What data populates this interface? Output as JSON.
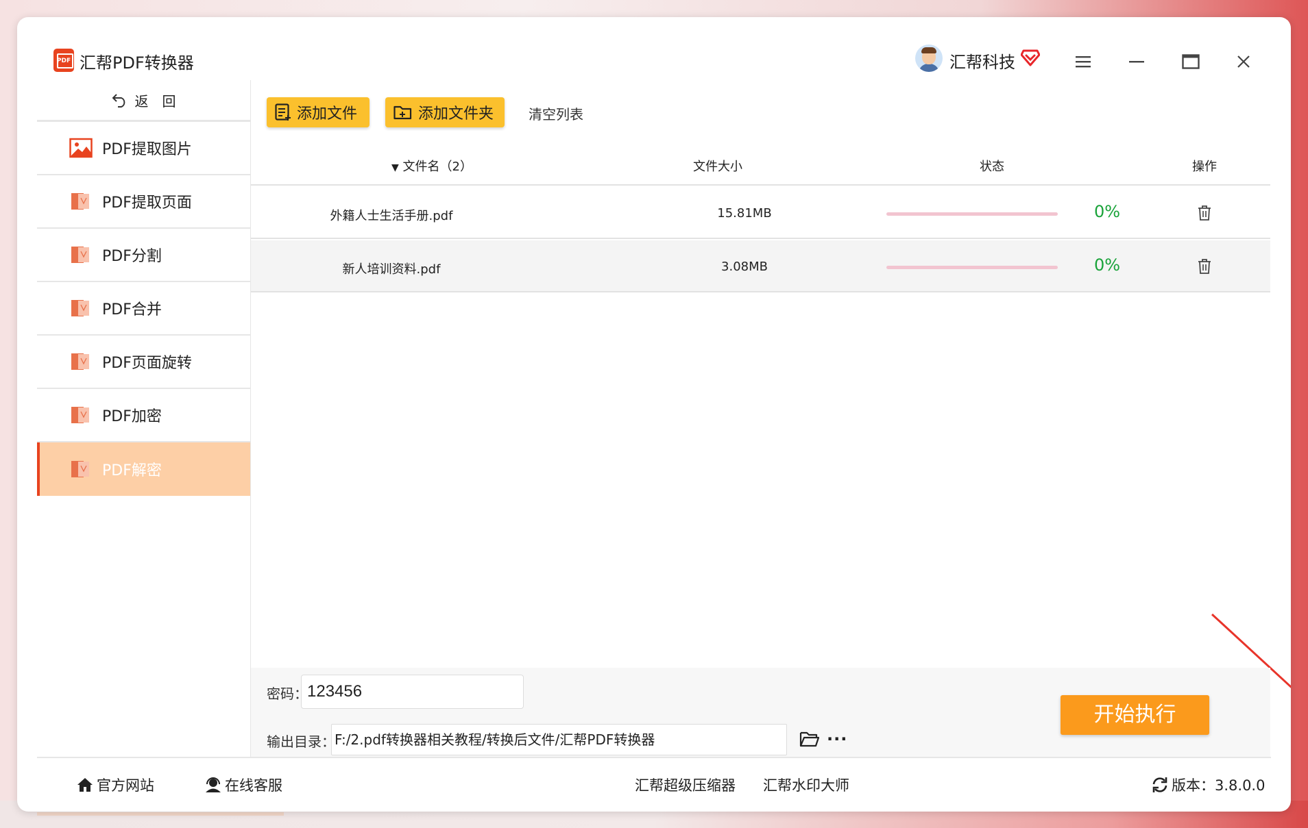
{
  "app": {
    "title": "汇帮PDF转换器",
    "logo_text": "PDF"
  },
  "user": {
    "name": "汇帮科技"
  },
  "sidebar": {
    "back_label": "返　回",
    "items": [
      {
        "label": "PDF提取图片",
        "icon": "image-icon",
        "active": false
      },
      {
        "label": "PDF提取页面",
        "icon": "pdf-file-icon",
        "active": false
      },
      {
        "label": "PDF分割",
        "icon": "pdf-file-icon",
        "active": false
      },
      {
        "label": "PDF合并",
        "icon": "pdf-file-icon",
        "active": false
      },
      {
        "label": "PDF页面旋转",
        "icon": "pdf-file-icon",
        "active": false
      },
      {
        "label": "PDF加密",
        "icon": "pdf-file-icon",
        "active": false
      },
      {
        "label": "PDF解密",
        "icon": "pdf-file-icon",
        "active": true
      }
    ]
  },
  "toolbar": {
    "add_file_label": "添加文件",
    "add_folder_label": "添加文件夹",
    "clear_label": "清空列表"
  },
  "table": {
    "headers": {
      "name": "文件名（2）",
      "size": "文件大小",
      "status": "状态",
      "action": "操作"
    },
    "rows": [
      {
        "name": "外籍人士生活手册.pdf",
        "size": "15.81MB",
        "progress_percent": 0,
        "pct_label": "0%"
      },
      {
        "name": "新人培训资料.pdf",
        "size": "3.08MB",
        "progress_percent": 0,
        "pct_label": "0%"
      }
    ]
  },
  "bottom": {
    "password_label": "密码：",
    "password_value": "123456",
    "output_label": "输出目录：",
    "output_value": "F:/2.pdf转换器相关教程/转换后文件/汇帮PDF转换器",
    "more_label": "···",
    "start_label": "开始执行"
  },
  "footer": {
    "website_label": "官方网站",
    "support_label": "在线客服",
    "link1": "汇帮超级压缩器",
    "link2": "汇帮水印大师",
    "version_label": "版本：3.8.0.0"
  },
  "colors": {
    "accent": "#fbc02d",
    "start_button": "#fb9a1c",
    "active_item": "#fdcfa6",
    "progress_text": "#1aa33a",
    "annotation_arrow": "#e8342a"
  }
}
